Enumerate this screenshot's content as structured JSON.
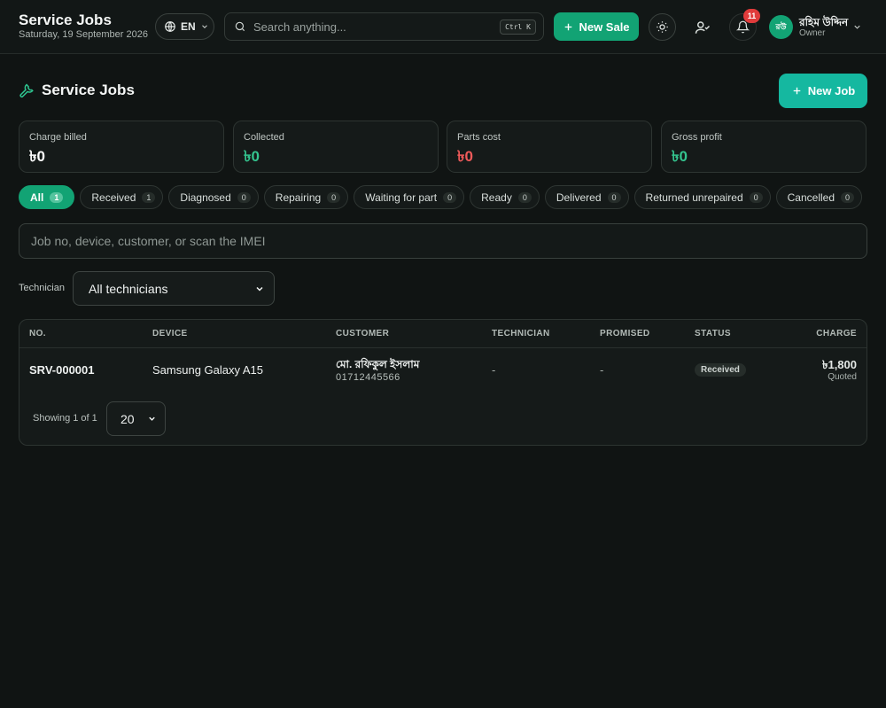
{
  "header": {
    "title": "Service Jobs",
    "date": "Saturday, 19 September 2026",
    "language": "EN",
    "search_placeholder": "Search anything...",
    "search_shortcut": "Ctrl K",
    "new_sale_label": "New Sale",
    "notification_count": "11",
    "user": {
      "initials": "রউ",
      "name": "রহিম উদ্দিন",
      "role": "Owner"
    }
  },
  "page": {
    "title": "Service Jobs",
    "new_job_label": "New Job"
  },
  "stats": [
    {
      "label": "Charge billed",
      "value": "৳0",
      "color": "#ffffff"
    },
    {
      "label": "Collected",
      "value": "৳0",
      "color": "#34c58f"
    },
    {
      "label": "Parts cost",
      "value": "৳0",
      "color": "#f05a5a"
    },
    {
      "label": "Gross profit",
      "value": "৳0",
      "color": "#34c58f"
    }
  ],
  "filters": [
    {
      "label": "All",
      "count": "1"
    },
    {
      "label": "Received",
      "count": "1"
    },
    {
      "label": "Diagnosed",
      "count": "0"
    },
    {
      "label": "Repairing",
      "count": "0"
    },
    {
      "label": "Waiting for part",
      "count": "0"
    },
    {
      "label": "Ready",
      "count": "0"
    },
    {
      "label": "Delivered",
      "count": "0"
    },
    {
      "label": "Returned unrepaired",
      "count": "0"
    },
    {
      "label": "Cancelled",
      "count": "0"
    }
  ],
  "job_search_placeholder": "Job no, device, customer, or scan the IMEI",
  "technician_filter": {
    "label": "Technician",
    "selected": "All technicians"
  },
  "table": {
    "columns": [
      "NO.",
      "DEVICE",
      "CUSTOMER",
      "TECHNICIAN",
      "PROMISED",
      "STATUS",
      "CHARGE"
    ],
    "rows": [
      {
        "no": "SRV-000001",
        "device": "Samsung Galaxy A15",
        "customer_name": "মো. রফিকুল ইসলাম",
        "customer_phone": "01712445566",
        "technician": "-",
        "promised": "-",
        "status": "Received",
        "charge": "৳1,800",
        "charge_note": "Quoted"
      }
    ]
  },
  "pagination": {
    "showing": "Showing 1 of 1",
    "page_size": "20"
  },
  "colors": {
    "accent": "#12a374",
    "accent_teal": "#15b8a0",
    "danger": "#e03b3b"
  }
}
